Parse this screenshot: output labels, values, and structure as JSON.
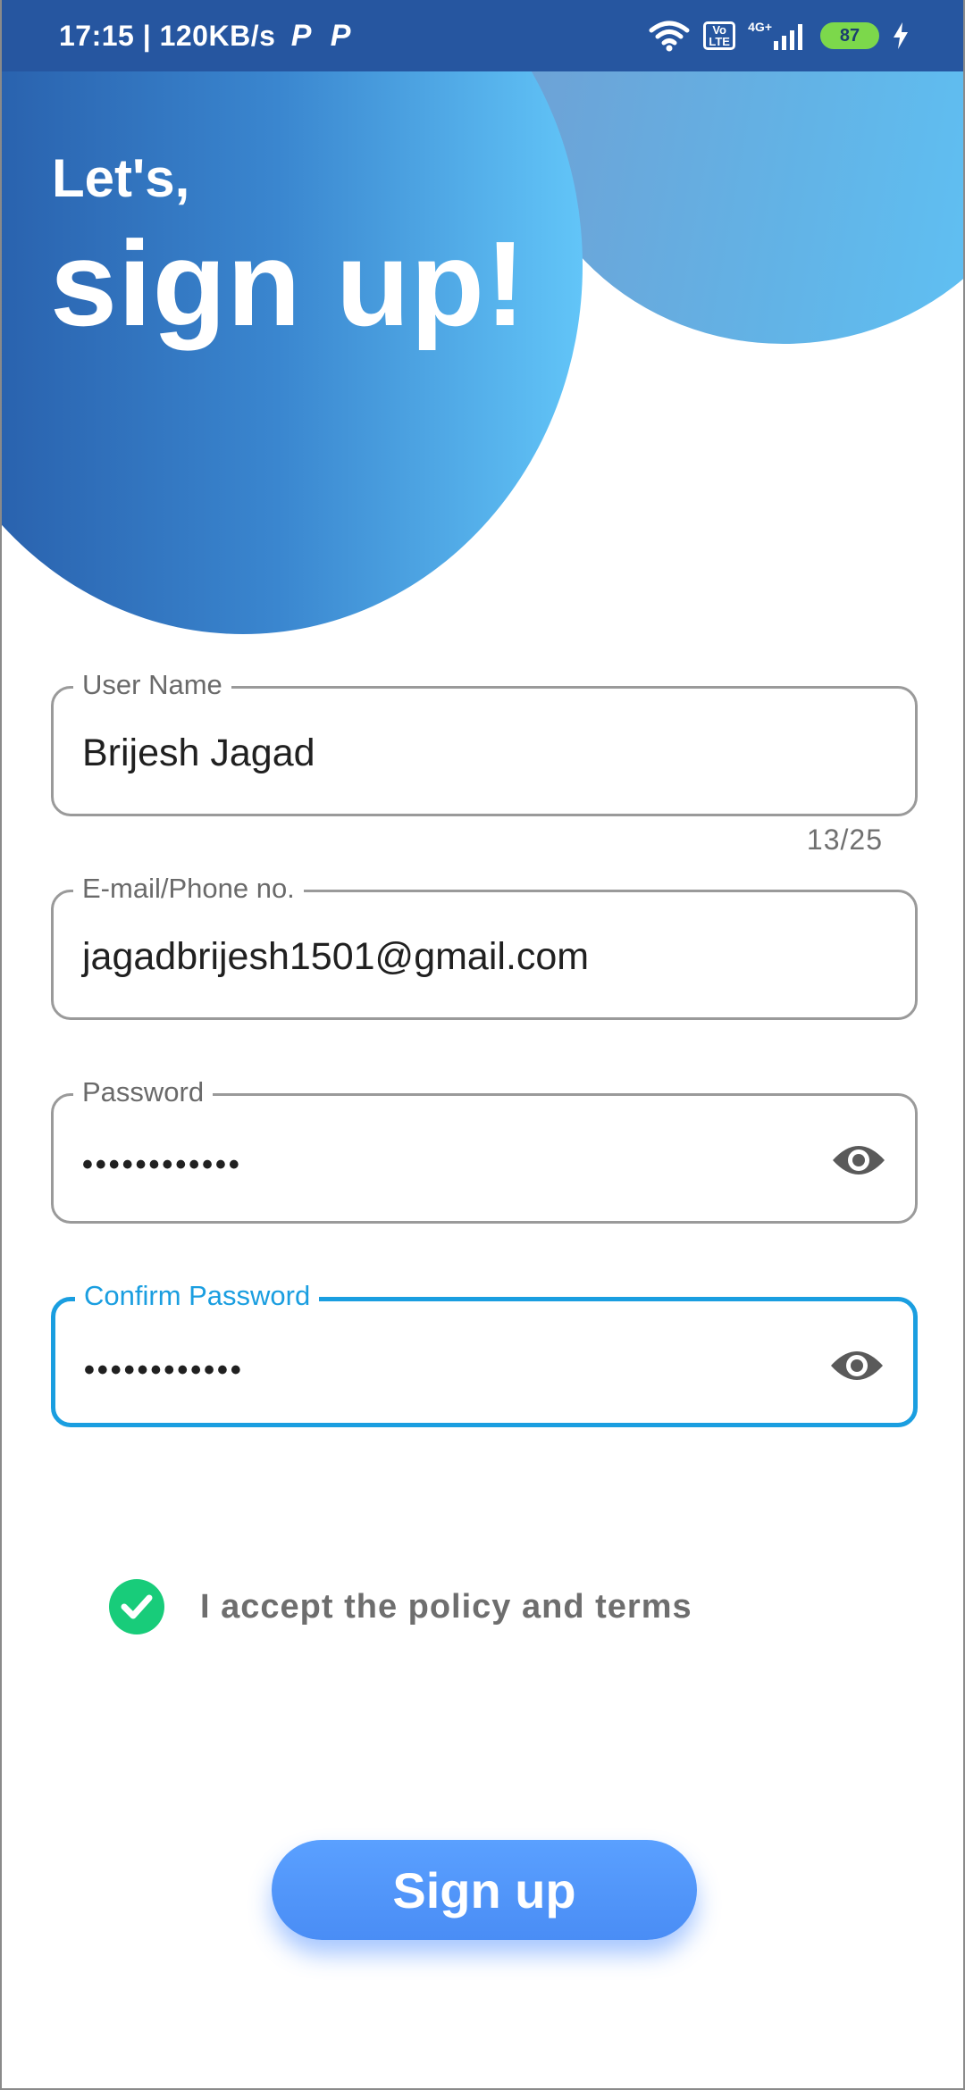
{
  "status_bar": {
    "time_speed": "17:15 | 120KB/s",
    "badge_1": "P",
    "badge_2": "P",
    "volte_top": "Vo",
    "volte_bottom": "LTE",
    "network": "4G+",
    "battery": "87",
    "bg_color": "#2656a0"
  },
  "header": {
    "greeting_small": "Let's,",
    "greeting_big": "sign up!"
  },
  "form": {
    "username": {
      "label": "User Name",
      "value": "Brijesh Jagad",
      "counter": "13/25"
    },
    "email": {
      "label": "E-mail/Phone no.",
      "value": "jagadbrijesh1501@gmail.com"
    },
    "password": {
      "label": "Password",
      "value": "••••••••••••"
    },
    "confirm_password": {
      "label": "Confirm Password",
      "value": "••••••••••••"
    },
    "focus_color": "#1a9ee0"
  },
  "policy": {
    "label": "I accept the policy and terms",
    "checked": true,
    "color": "#18cc7a"
  },
  "actions": {
    "signup_label": "Sign up",
    "button_color": "#4a8df5"
  },
  "icons": [
    "wifi-icon",
    "signal-icon",
    "charging-icon",
    "eye-icon",
    "check-icon"
  ]
}
